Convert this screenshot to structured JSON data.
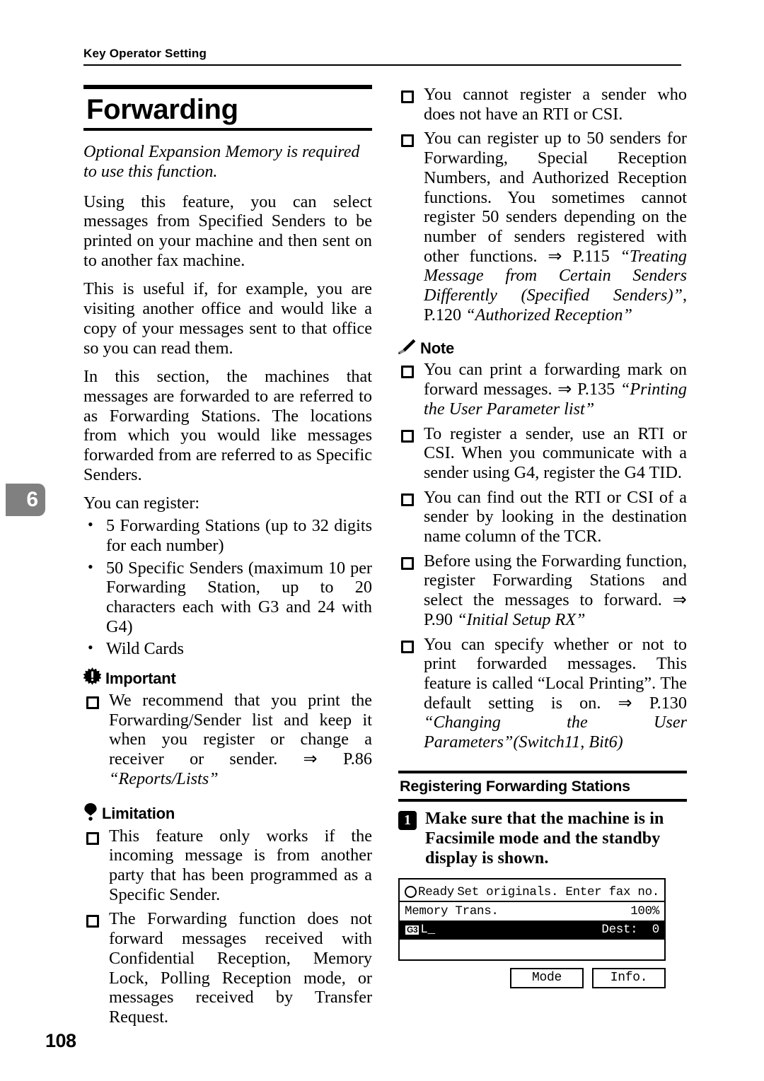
{
  "header": {
    "running_head": "Key Operator Setting"
  },
  "chapter_tab": {
    "number": "6"
  },
  "folio": "108",
  "left_column": {
    "chapter_title": "Forwarding",
    "intro_italic": "Optional Expansion Memory is required to use this function.",
    "paragraphs": [
      "Using this feature, you can select messages from Specified Senders to be printed on your machine and then sent on to another fax machine.",
      "This is useful if, for example, you are visiting another office and would like a copy of your messages sent to that office so you can read them.",
      "In this section, the machines that messages are forwarded to are referred to as Forwarding Stations. The locations from which you would like messages forwarded from are referred to as Specific Senders."
    ],
    "register_lead": "You can register:",
    "bullets": [
      "5 Forwarding Stations (up to 32 digits for each number)",
      "50 Specific Senders (maximum 10 per Forwarding Station, up to 20 characters each with G3 and 24 with G4)",
      "Wild Cards"
    ],
    "important": {
      "label": "Important",
      "icon": "burst-exclamation-icon",
      "items": [
        {
          "text": "We recommend that you print the Forwarding/Sender list and keep it when you register or change a receiver or sender. ",
          "arrow": "⇒",
          "ref_page": " P.86 ",
          "ref_title": "“Reports/Lists”"
        }
      ]
    },
    "limitation": {
      "label": "Limitation",
      "icon": "exclamation-balloon-icon",
      "items": [
        "This feature only works if the incoming message is from another party that has been programmed as a Specific Sender.",
        "The Forwarding function does not forward messages received with Confidential Reception, Memory Lock, Polling Reception mode, or messages received by Transfer Request."
      ]
    }
  },
  "right_column": {
    "limitation_continued": [
      {
        "text": "You cannot register a sender who does not have an RTI or CSI.",
        "arrow": "",
        "ref": ""
      },
      {
        "text": "You can register up to 50 senders for Forwarding, Special Reception Numbers, and Authorized Reception functions. You sometimes cannot register 50 senders depending on the number of senders registered with other functions. ",
        "arrow": "⇒",
        "ref_page": " P.115 ",
        "ref_title_1": "“Treating Message from Certain Senders Differently (Specified Senders)”",
        "ref_mid": ", P.120 ",
        "ref_title_2": "“Authorized Reception”"
      }
    ],
    "note": {
      "label": "Note",
      "icon": "pencil-icon",
      "items": [
        {
          "text": "You can print a forwarding mark on forward messages. ",
          "arrow": "⇒",
          "ref_page": " P.135 ",
          "ref_title": "“Printing the User Parameter list”"
        },
        {
          "text": "To register a sender, use an RTI or CSI. When you communicate with a sender using G4, register the G4 TID.",
          "arrow": "",
          "ref_page": "",
          "ref_title": ""
        },
        {
          "text": "You can find out the RTI or CSI of a sender by looking in the destination name column of the TCR.",
          "arrow": "",
          "ref_page": "",
          "ref_title": ""
        },
        {
          "text": "Before using the Forwarding function, register Forwarding Stations and select the messages to forward. ",
          "arrow": "⇒",
          "ref_page": " P.90 ",
          "ref_title": "“Initial Setup RX”"
        },
        {
          "text": "You can specify whether or not to print forwarded messages. This feature is called “Local Printing”. The default setting is on. ",
          "arrow": "⇒",
          "ref_page": " P.130 ",
          "ref_title": "“Changing the User Parameters”",
          "ref_suffix": "(Switch11, Bit6)"
        }
      ]
    },
    "subsection": {
      "title": "Registering Forwarding Stations",
      "step": {
        "number": "1",
        "text": "Make sure that the machine is in Facsimile mode and the standby display is shown."
      }
    },
    "lcd": {
      "status_dot": "ready-circle-icon",
      "status": "Ready",
      "prompt": "Set originals. Enter fax no.",
      "mode_label": "Memory Trans.",
      "memory_percent": "100%",
      "line_badge": "G3",
      "line_suffix": "L",
      "cursor": "_",
      "dest_label": "Dest:",
      "dest_value": "0",
      "buttons": [
        "Mode",
        "Info."
      ]
    }
  }
}
